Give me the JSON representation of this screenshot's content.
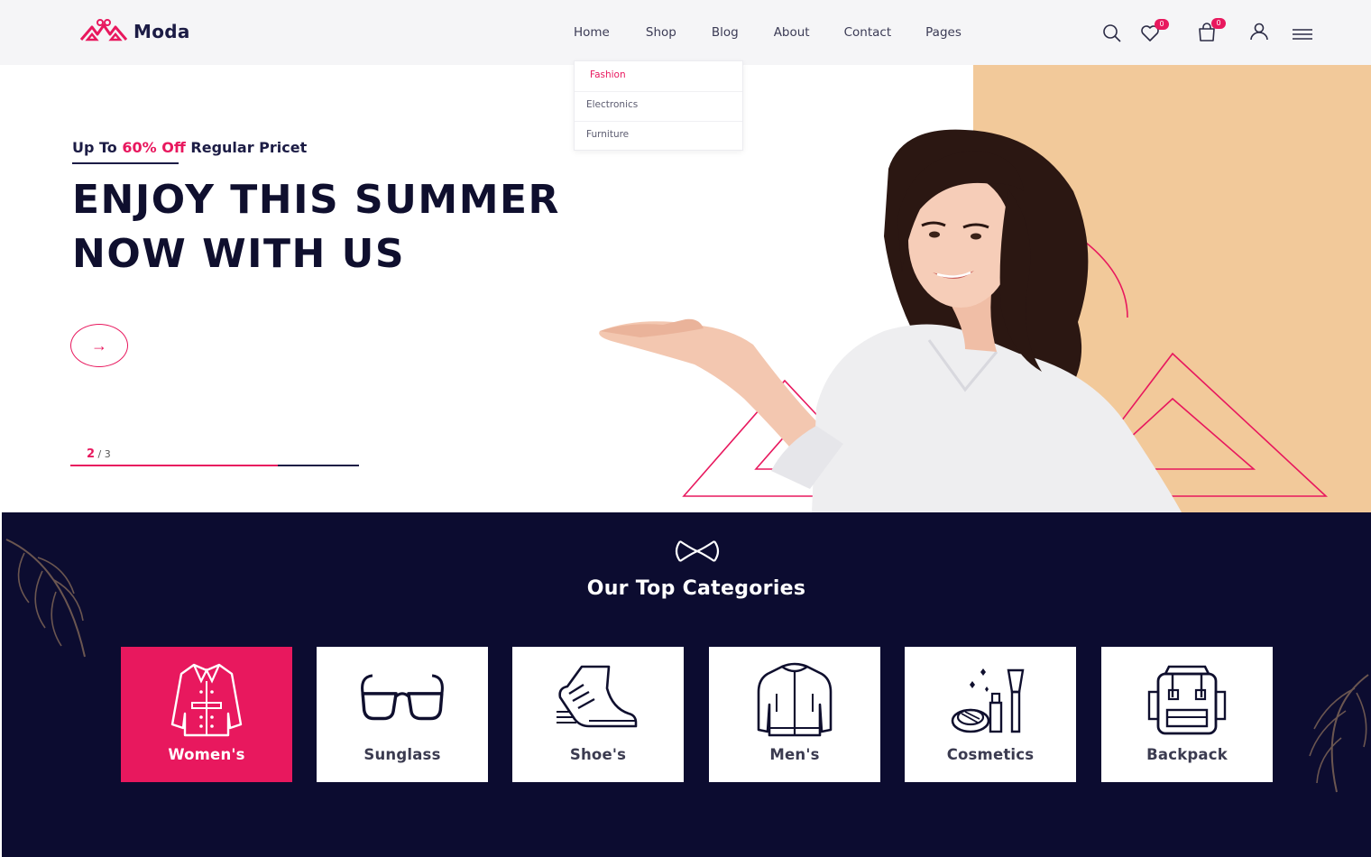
{
  "brand": {
    "name": "Moda",
    "accent": "#e8185e",
    "navy": "#0c0c30",
    "peach": "#f2c99a"
  },
  "nav": {
    "items": [
      "Home",
      "Shop",
      "Blog",
      "About",
      "Contact",
      "Pages"
    ],
    "dropdown": [
      "Fashion",
      "Electronics",
      "Furniture"
    ]
  },
  "header_icons": {
    "search": "search-icon",
    "wishlist": {
      "icon": "heart-icon",
      "count": "0"
    },
    "cart": {
      "icon": "bag-icon",
      "count": "0"
    },
    "account": "user-icon",
    "menu": "hamburger-icon"
  },
  "hero": {
    "offer_prefix": "Up To",
    "offer_highlight": "60% Off",
    "offer_suffix": "Regular Pricet",
    "headline_line1": "ENJOY THIS SUMMER",
    "headline_line2": "NOW WITH US",
    "arrow": "→",
    "slide_current": "2",
    "slide_total": "/ 3",
    "slide_progress": 0.72
  },
  "categories": {
    "title": "Our Top Categories",
    "items": [
      {
        "label": "Women's",
        "icon": "coat-icon"
      },
      {
        "label": "Sunglass",
        "icon": "sunglasses-icon"
      },
      {
        "label": "Shoe's",
        "icon": "sneaker-icon"
      },
      {
        "label": "Men's",
        "icon": "jacket-icon"
      },
      {
        "label": "Cosmetics",
        "icon": "cosmetics-icon"
      },
      {
        "label": "Backpack",
        "icon": "backpack-icon"
      }
    ]
  }
}
